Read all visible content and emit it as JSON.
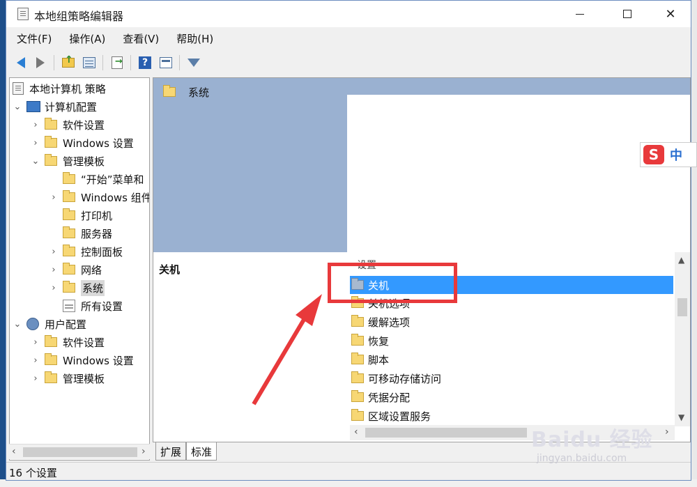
{
  "window": {
    "title": "本地组策略编辑器"
  },
  "menu": [
    {
      "label": "文件(F)"
    },
    {
      "label": "操作(A)"
    },
    {
      "label": "查看(V)"
    },
    {
      "label": "帮助(H)"
    }
  ],
  "tree": {
    "root": "本地计算机 策略",
    "computer_config": "计算机配置",
    "software_settings": "软件设置",
    "windows_settings": "Windows 设置",
    "admin_templates": "管理模板",
    "start_menu": "“开始”菜单和",
    "windows_components": "Windows 组件",
    "printers": "打印机",
    "server": "服务器",
    "control_panel": "控制面板",
    "network": "网络",
    "system": "系统",
    "all_settings": "所有设置",
    "user_config": "用户配置",
    "user_software_settings": "软件设置",
    "user_windows_settings": "Windows 设置",
    "user_admin_templates": "管理模板"
  },
  "right": {
    "header_title": "系统",
    "description_label": "关机",
    "list_header": "设置",
    "items": [
      {
        "label": "关机"
      },
      {
        "label": "关机选项"
      },
      {
        "label": "缓解选项"
      },
      {
        "label": "恢复"
      },
      {
        "label": "脚本"
      },
      {
        "label": "可移动存储访问"
      },
      {
        "label": "凭据分配"
      },
      {
        "label": "区域设置服务"
      }
    ]
  },
  "tabs": [
    {
      "label": "扩展"
    },
    {
      "label": "标准"
    }
  ],
  "status": {
    "text": "16 个设置"
  },
  "ime": {
    "logo": "S",
    "lang": "中"
  },
  "watermark": {
    "main": "Baidu 经验",
    "sub": "jingyan.baidu.com"
  },
  "colors": {
    "selection": "#3399ff",
    "highlight": "#e8393b",
    "header_band": "#9ab1d1"
  }
}
